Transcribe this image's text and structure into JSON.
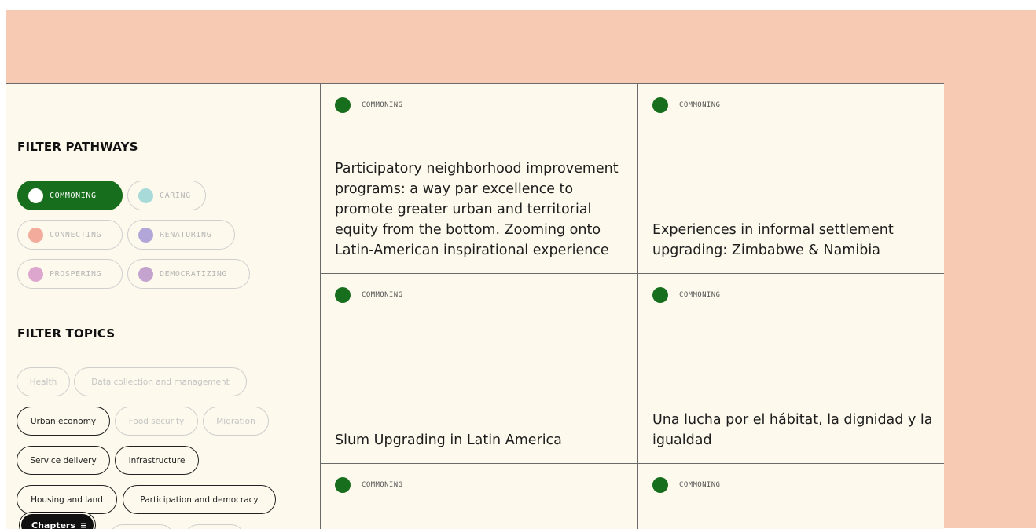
{
  "sidebar": {
    "pathways_heading": "FILTER PATHWAYS",
    "pathways": [
      {
        "label": "COMMONING",
        "color": "#ffffff",
        "active": true
      },
      {
        "label": "CARING",
        "color": "#a9dada",
        "active": false
      },
      {
        "label": "CONNECTING",
        "color": "#f3ab9c",
        "active": false
      },
      {
        "label": "RENATURING",
        "color": "#b2a6d8",
        "active": false
      },
      {
        "label": "PROSPERING",
        "color": "#dca6cf",
        "active": false
      },
      {
        "label": "DEMOCRATIZING",
        "color": "#c4a3cf",
        "active": false
      }
    ],
    "topics_heading": "FILTER TOPICS",
    "topics": [
      {
        "label": "Health",
        "active": false
      },
      {
        "label": "Data collection and management",
        "active": false
      },
      {
        "label": "Urban economy",
        "active": true
      },
      {
        "label": "Food security",
        "active": false
      },
      {
        "label": "Migration",
        "active": false
      },
      {
        "label": "Service delivery",
        "active": true
      },
      {
        "label": "Infrastructure",
        "active": true
      },
      {
        "label": "Housing and land",
        "active": true
      },
      {
        "label": "Participation and democracy",
        "active": true
      }
    ],
    "chapters_label": "Chapters",
    "chapters_icon": "≡"
  },
  "cards": [
    {
      "tag": "COMMONING",
      "title": "Participatory neighborhood improvement programs: a way par excellence to promote greater urban and territorial equity from the bottom. Zooming onto Latin-American inspirational experience"
    },
    {
      "tag": "COMMONING",
      "title": "Experiences in informal settlement upgrading: Zimbabwe & Namibia"
    },
    {
      "tag": "COMMONING",
      "title": "Slum Upgrading in Latin America"
    },
    {
      "tag": "COMMONING",
      "title": "Una lucha por el hábitat, la dignidad y la igualdad"
    },
    {
      "tag": "COMMONING",
      "title": ""
    },
    {
      "tag": "COMMONING",
      "title": ""
    }
  ],
  "colors": {
    "background": "#f7cbb3",
    "panel": "#fdf9ed",
    "accent_green": "#176e1c"
  }
}
